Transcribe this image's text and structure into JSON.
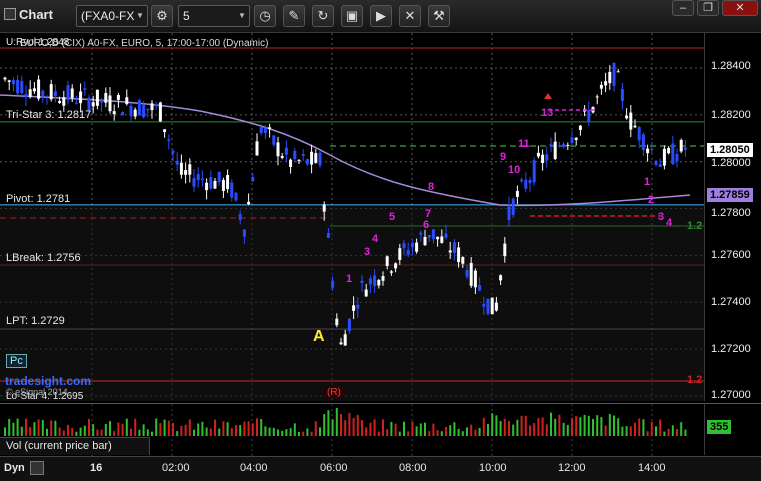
{
  "toolbar": {
    "title": "Chart",
    "symbol": "(FXA0-FX",
    "interval": "5",
    "buttons": [
      "gear-icon",
      "clock-icon",
      "pencil-icon",
      "refresh-icon",
      "camera-icon",
      "play-icon",
      "close-icon",
      "tools-icon"
    ]
  },
  "chart": {
    "header_primary": "U:Rvol 1.2848",
    "header_secondary": "EURO,D (CIX) A0-FX, EURO, 5, 17:00-17:00 (Dynamic)",
    "levels": [
      {
        "name": "Tri-Star 3",
        "label": "Tri-Star 3: 1.2817",
        "color": "#2e8b2e"
      },
      {
        "name": "Pivot",
        "label": "Pivot: 1.2781",
        "color": "#3aa0e0"
      },
      {
        "name": "LBreak",
        "label": "LBreak: 1.2756",
        "color": "#d02020"
      },
      {
        "name": "LPT",
        "label": "LPT: 1.2729",
        "color": "#8a70b0"
      },
      {
        "name": "Lo-Star 4",
        "label": "Lo-Star 4: 1.2695",
        "color": "#d02020"
      }
    ],
    "annotation_a": "A",
    "pc_badge": "Pc",
    "brand": "tradesight.com",
    "copyright": "© eSignal 2014",
    "recovery_marker": "(R)"
  },
  "price_axis": {
    "ticks": [
      "1.28400",
      "1.28200",
      "1.28000",
      "1.27800",
      "1.27600",
      "1.27400",
      "1.27200",
      "1.27000"
    ],
    "current_price": "1.28050",
    "ma_price": "1.27859",
    "green_marker": "1.2",
    "red_marker": "1.2"
  },
  "volume": {
    "label": "Vol (current price bar)",
    "value": "355"
  },
  "time_axis": {
    "mode": "Dyn",
    "labels": [
      "16",
      "02:00",
      "04:00",
      "06:00",
      "08:00",
      "10:00",
      "12:00",
      "14:00"
    ]
  },
  "colors": {
    "up_bar": "#ffffff",
    "down_bar": "#2a4cff",
    "ma": "#a58ad8",
    "magenta": "#e020e0",
    "green_count": "#28a028"
  },
  "setup_counts": [
    {
      "text": "1",
      "color": "magenta"
    },
    {
      "text": "3",
      "color": "magenta"
    },
    {
      "text": "4",
      "color": "magenta"
    },
    {
      "text": "5",
      "color": "magenta"
    },
    {
      "text": "6",
      "color": "magenta"
    },
    {
      "text": "7",
      "color": "magenta"
    },
    {
      "text": "8",
      "color": "magenta"
    },
    {
      "text": "9",
      "color": "magenta"
    },
    {
      "text": "10",
      "color": "magenta"
    },
    {
      "text": "11",
      "color": "magenta"
    },
    {
      "text": "13",
      "color": "magenta"
    },
    {
      "text": "1",
      "color": "magenta"
    },
    {
      "text": "2",
      "color": "magenta"
    },
    {
      "text": "3",
      "color": "magenta"
    },
    {
      "text": "4",
      "color": "magenta"
    }
  ]
}
